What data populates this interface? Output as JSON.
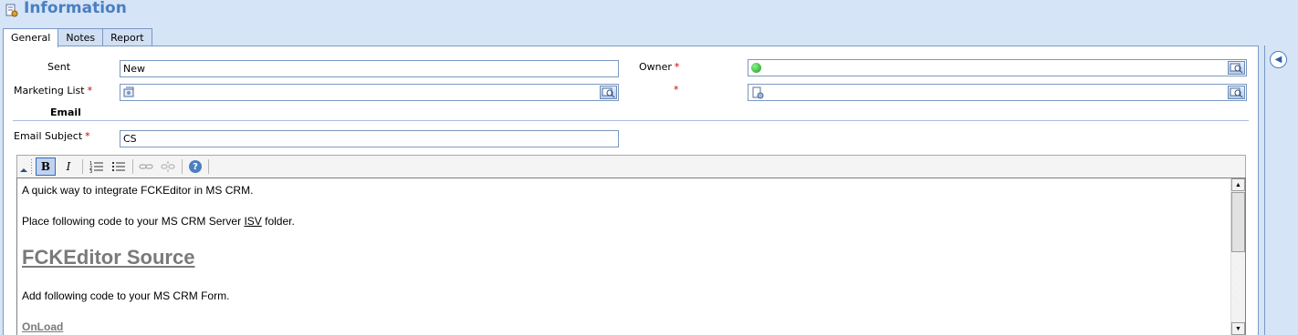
{
  "header": {
    "title": "Information",
    "icon": "form-icon"
  },
  "tabs": [
    {
      "label": "General",
      "active": true
    },
    {
      "label": "Notes",
      "active": false
    },
    {
      "label": "Report",
      "active": false
    }
  ],
  "form": {
    "sent": {
      "label": "Sent",
      "value": "New"
    },
    "owner": {
      "label": "Owner",
      "required_mark": "*"
    },
    "marketing_list": {
      "label": "Marketing List",
      "required_mark": "*"
    },
    "hidden_field": {
      "required_mark": "*"
    },
    "email_section": {
      "title": "Email"
    },
    "email_subject": {
      "label": "Email Subject",
      "required_mark": "*",
      "value": "CS"
    }
  },
  "editor": {
    "toolbar": {
      "bold": "B",
      "italic": "I"
    },
    "content": {
      "p1": "A quick way to integrate FCKEditor in MS CRM.",
      "p2_before": "Place following code to your MS CRM Server ",
      "p2_isv": "ISV",
      "p2_after": " folder.",
      "heading": "FCKEditor Source",
      "p3": "Add following code to your MS CRM Form.",
      "onload": "OnLoad"
    }
  },
  "colors": {
    "background": "#d6e4f7",
    "title": "#4a7fc1",
    "border": "#7a98c2",
    "required": "#cc0000",
    "owner_status": "#22aa22"
  }
}
